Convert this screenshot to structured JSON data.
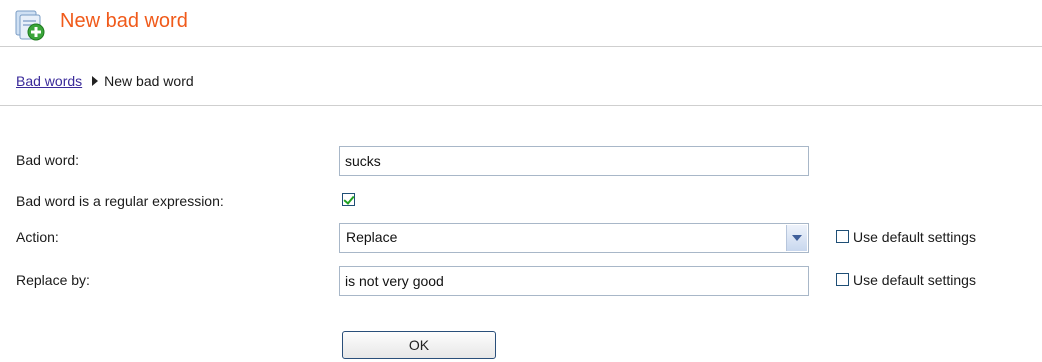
{
  "header": {
    "title": "New bad word",
    "icon": "documents-add-icon"
  },
  "breadcrumb": {
    "parent_label": "Bad words",
    "current_label": "New bad word"
  },
  "form": {
    "bad_word": {
      "label": "Bad word:",
      "value": "sucks"
    },
    "regex": {
      "label": "Bad word is a regular expression:",
      "checked": true
    },
    "action": {
      "label": "Action:",
      "selected": "Replace",
      "use_default_label": "Use default settings",
      "use_default_checked": false
    },
    "replace_by": {
      "label": "Replace by:",
      "value": "is not very good",
      "use_default_label": "Use default settings",
      "use_default_checked": false
    }
  },
  "buttons": {
    "ok_label": "OK"
  },
  "colors": {
    "title": "#f05a1a",
    "link": "#3a2a9a",
    "check": "#21a121"
  }
}
